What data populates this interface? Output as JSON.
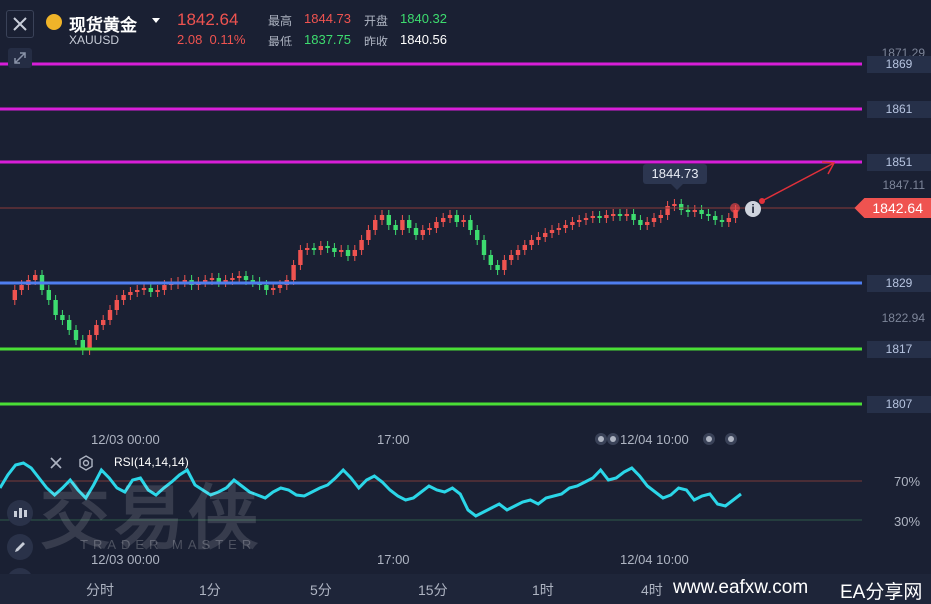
{
  "header": {
    "close_label": "close",
    "name": "现货黄金",
    "symbol": "XAUUSD",
    "price": "1842.64",
    "change": "2.08",
    "change_pct": "0.11%",
    "high_label": "最高",
    "high": "1844.73",
    "open_label": "开盘",
    "open": "1840.32",
    "low_label": "最低",
    "low": "1837.75",
    "prev_label": "昨收",
    "prev": "1840.56"
  },
  "levels": {
    "l1869": "1869",
    "l1861": "1861",
    "l1851": "1851",
    "l1829": "1829",
    "l1817": "1817",
    "l1807": "1807"
  },
  "axis": {
    "top": "1871.29",
    "a1847": "1847.11",
    "a1822": "1822.94"
  },
  "current_price": "1842.64",
  "tooltip": "1844.73",
  "time_axis": {
    "t1": "12/03 00:00",
    "t2": "17:00",
    "t3": "12/04 10:00"
  },
  "rsi": {
    "label": "RSI(14,14,14)",
    "hi": "70%",
    "lo": "30%"
  },
  "watermark": {
    "main": "交易侠",
    "sub": "TRADER MASTER"
  },
  "timeframes": [
    "分时",
    "1分",
    "5分",
    "15分",
    "1时",
    "4时"
  ],
  "footer": {
    "site": "www.eafxw.com",
    "brand": "EA分享网"
  },
  "colors": {
    "magenta": "#d81ed8",
    "blue": "#4f7ef0",
    "green": "#4ade36",
    "up": "#ef5350",
    "down": "#3ddc6f",
    "rsi": "#2bd6e8"
  }
}
